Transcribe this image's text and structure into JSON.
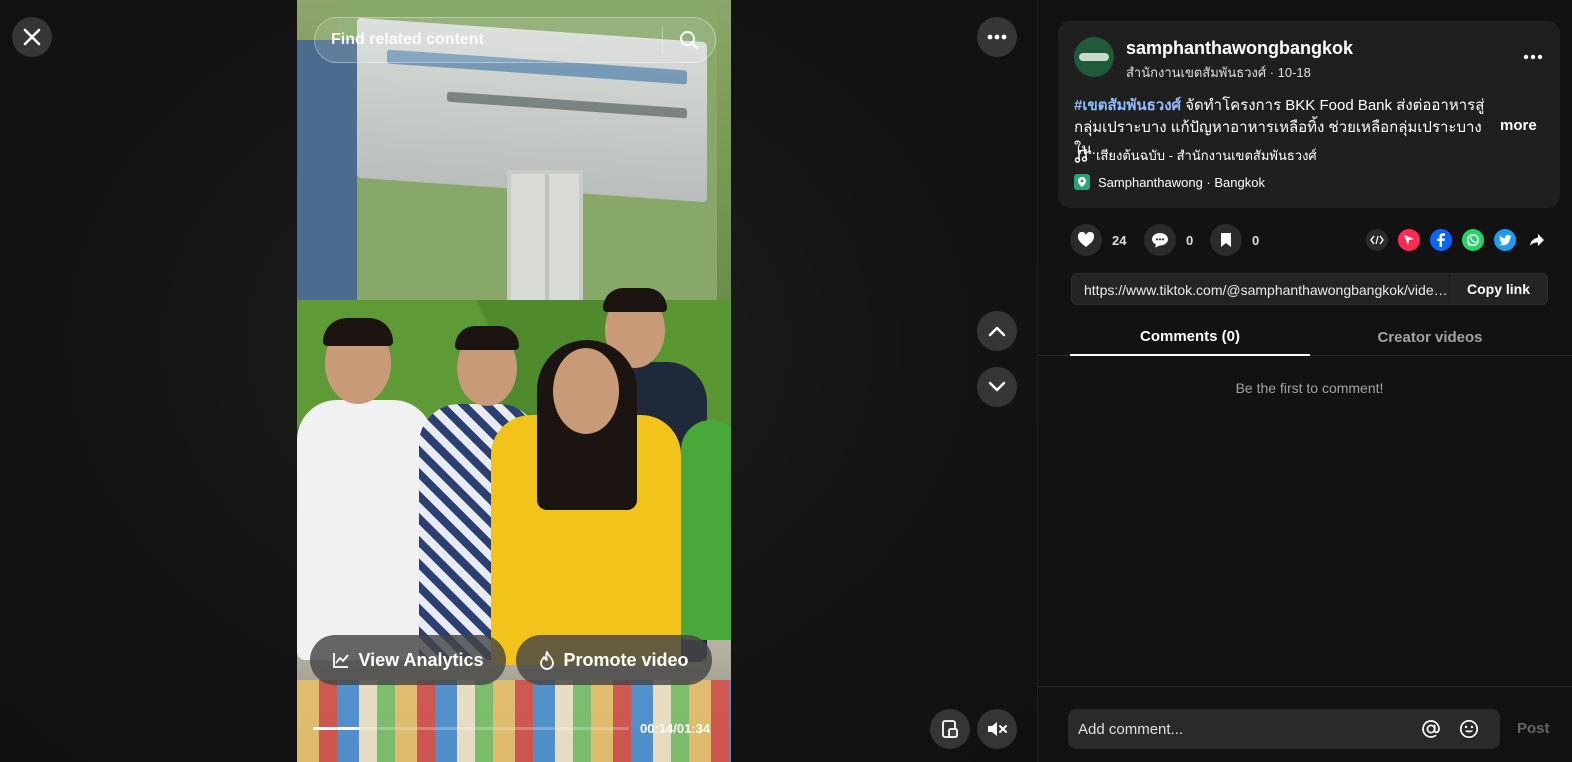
{
  "video": {
    "search_placeholder": "Find related content",
    "analytics_label": "View Analytics",
    "promote_label": "Promote video",
    "time_display": "00:14/01:34",
    "progress_fraction": 0.149
  },
  "icons": {
    "close": "close-icon",
    "search": "search-icon",
    "more": "more-horizontal-icon",
    "up": "chevron-up-icon",
    "down": "chevron-down-icon",
    "floating": "floating-player-icon",
    "mute": "muted-speaker-icon",
    "analytics": "line-chart-icon",
    "promote": "flame-icon"
  },
  "post": {
    "username": "samphanthawongbangkok",
    "subline": "สำนักงานเขตสัมพันธวงศ์ · 10-18",
    "hashtag": "#เขตสัมพันธวงศ์",
    "description": " จัดทำโครงการ BKK Food Bank ส่งต่ออาหารสู่กลุ่มเปราะบาง แก้ปัญหาอาหารเหลือทิ้ง ช่วยเหลือกลุ่มเปราะบางใน...",
    "more_label": "more",
    "music": "เสียงต้นฉบับ - สำนักงานเขตสัมพันธวงศ์",
    "location": "Samphanthawong · Bangkok"
  },
  "stats": {
    "likes": "24",
    "comments": "0",
    "saves": "0"
  },
  "share": {
    "link": "https://www.tiktok.com/@samphanthawongbangkok/video/...",
    "copy_label": "Copy link",
    "colors": {
      "embed": "#2b2b2b",
      "send": "#fe2c55",
      "facebook": "#0866ff",
      "whatsapp": "#25d366",
      "twitter": "#1d9bf0"
    }
  },
  "tabs": {
    "comments": "Comments (0)",
    "creator": "Creator videos"
  },
  "comments": {
    "empty_message": "Be the first to comment!",
    "input_placeholder": "Add comment...",
    "post_label": "Post"
  }
}
